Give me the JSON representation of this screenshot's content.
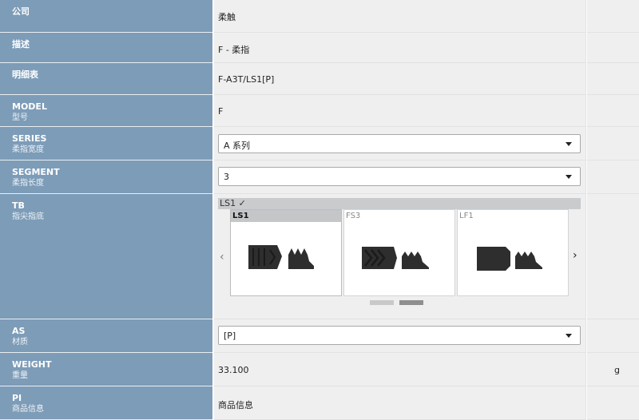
{
  "rows": {
    "company": {
      "label": "公司",
      "value": "柔触"
    },
    "description": {
      "label": "描述",
      "value": "F - 柔指"
    },
    "spec": {
      "label": "明细表",
      "value": "F-A3T/LS1[P]"
    },
    "model": {
      "label": "MODEL",
      "sublabel": "型号",
      "value": "F"
    },
    "series": {
      "label": "SERIES",
      "sublabel": "柔指宽度",
      "value": "A 系列"
    },
    "segment": {
      "label": "SEGMENT",
      "sublabel": "柔指长度",
      "value": "3"
    },
    "tb": {
      "label": "TB",
      "sublabel": "指尖指底",
      "selected_text": "LS1 ✓",
      "options": [
        {
          "name": "LS1",
          "selected": true
        },
        {
          "name": "FS3",
          "selected": false
        },
        {
          "name": "LF1",
          "selected": false
        }
      ],
      "prev_arrow": "‹",
      "next_arrow": "›",
      "page_count": 2,
      "active_page": 2
    },
    "as": {
      "label": "AS",
      "sublabel": "材质",
      "value": "[P]"
    },
    "weight": {
      "label": "WEIGHT",
      "sublabel": "重量",
      "value": "33.100",
      "unit": "g"
    },
    "pi": {
      "label": "PI",
      "sublabel": "商品信息",
      "value": "商品信息"
    }
  },
  "colors": {
    "label_bg": "#7d9cb8",
    "value_bg": "#efefef",
    "product": "#2e2e2e"
  },
  "icons": {
    "dropdown": "chevron-down-icon",
    "prev": "chevron-left-icon",
    "next": "chevron-right-icon"
  }
}
